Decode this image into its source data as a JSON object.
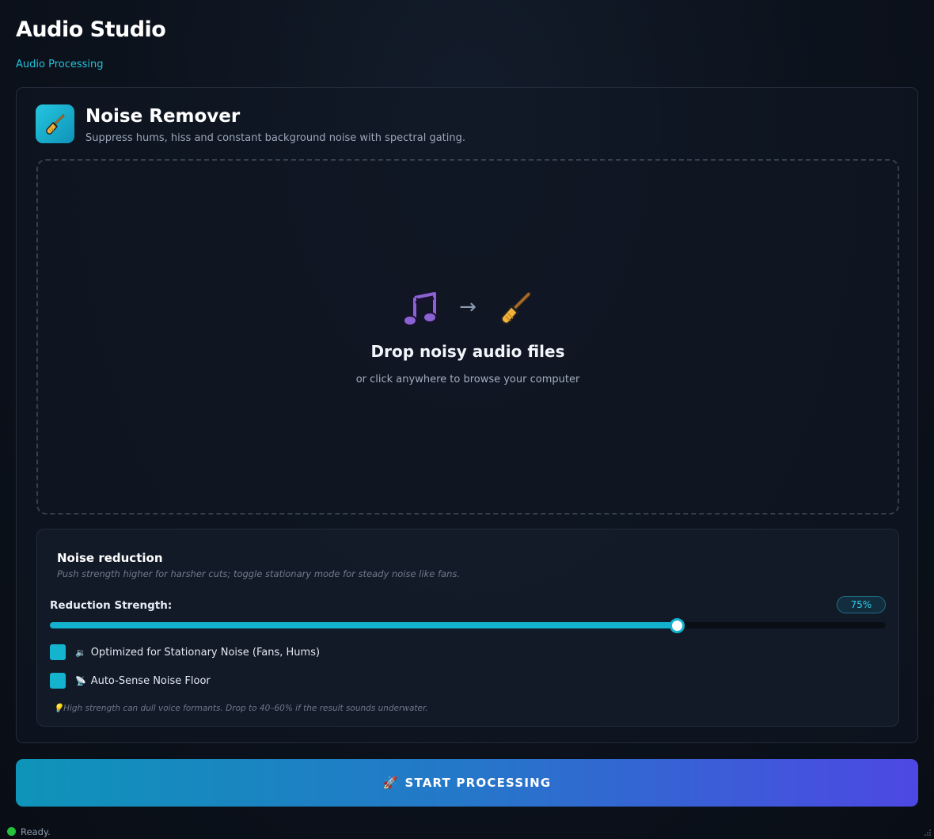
{
  "app": {
    "title": "Audio Studio",
    "subtitle": "Audio Processing"
  },
  "tool": {
    "icon": "broom-icon",
    "title": "Noise Remover",
    "description": "Suppress hums, hiss and constant background noise with spectral gating."
  },
  "dropzone": {
    "icons": [
      "music-note-icon",
      "arrow-right-icon",
      "broom-icon"
    ],
    "arrow": "→",
    "title": "Drop noisy audio files",
    "hint": "or click anywhere to browse your computer"
  },
  "settings": {
    "title": "Noise reduction",
    "description": "Push strength higher for harsher cuts; toggle stationary mode for steady noise like fans.",
    "strength_label": "Reduction Strength:",
    "strength_value": "75%",
    "strength_percent": 75,
    "options": [
      {
        "icon": "speaker-icon",
        "emoji": "🔉",
        "label": "Optimized for Stationary Noise (Fans, Hums)",
        "checked": true
      },
      {
        "icon": "satellite-dish-icon",
        "emoji": "📡",
        "label": "Auto-Sense Noise Floor",
        "checked": true
      }
    ],
    "tip_icon": "lightbulb-icon",
    "tip_emoji": "💡",
    "tip": "High strength can dull voice formants. Drop to 40–60% if the result sounds underwater."
  },
  "actions": {
    "start_icon": "rocket-icon",
    "start_emoji": "🚀",
    "start_label": "START PROCESSING"
  },
  "status": {
    "text": "Ready.",
    "color": "#22c23c"
  },
  "colors": {
    "accent": "#13b3d0",
    "button_gradient_start": "#0e94b9",
    "button_gradient_end": "#4d48e3"
  }
}
